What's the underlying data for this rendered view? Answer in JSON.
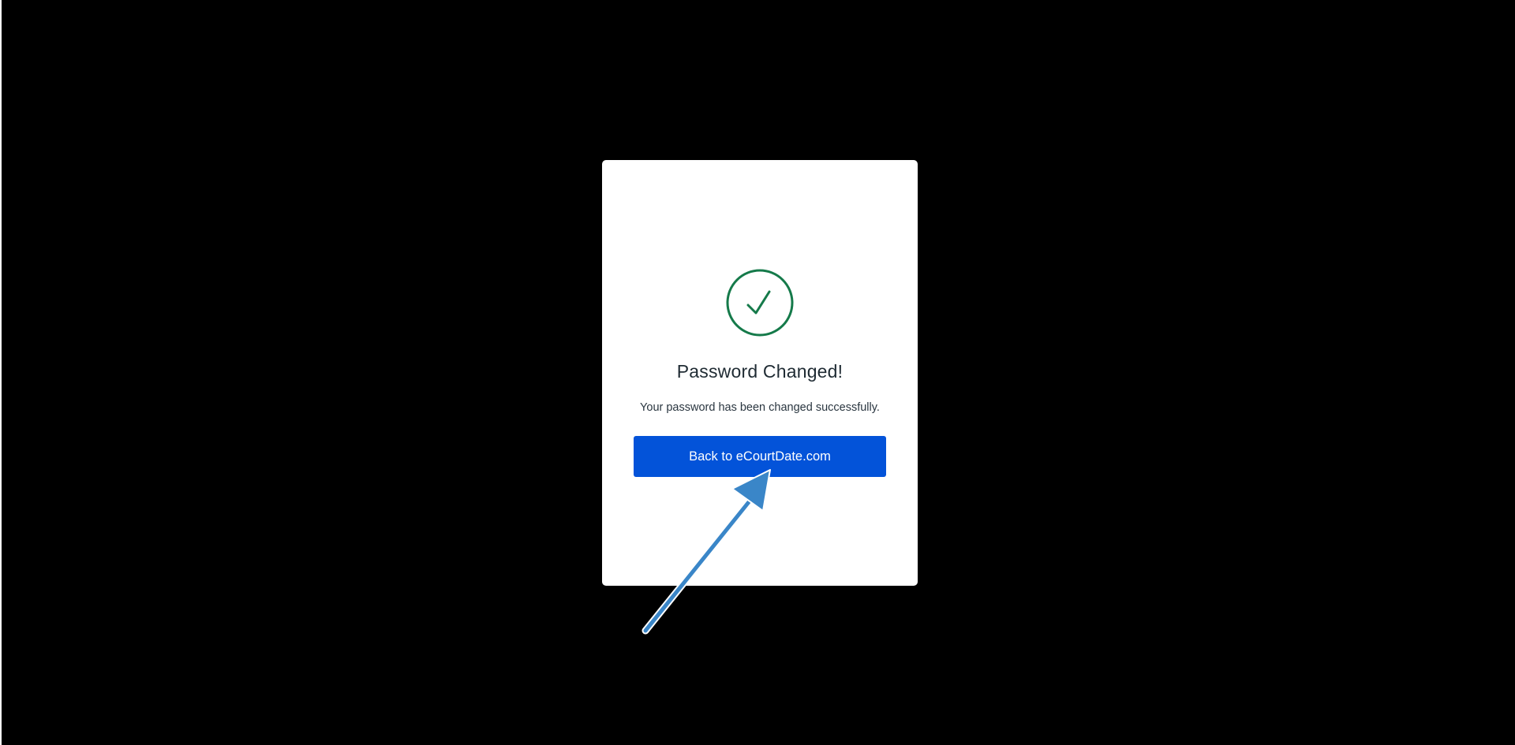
{
  "dialog": {
    "icon": "check-circle-icon",
    "title": "Password Changed!",
    "message": "Your password has been changed successfully.",
    "button_label": "Back to eCourtDate.com"
  },
  "annotation": {
    "icon": "arrow-pointer-icon"
  },
  "colors": {
    "background": "#000000",
    "card": "#ffffff",
    "success": "#157a4a",
    "button": "#0353d9",
    "button_text": "#ffffff",
    "arrow": "#3a86c8",
    "arrow_outline": "#ffffff"
  }
}
